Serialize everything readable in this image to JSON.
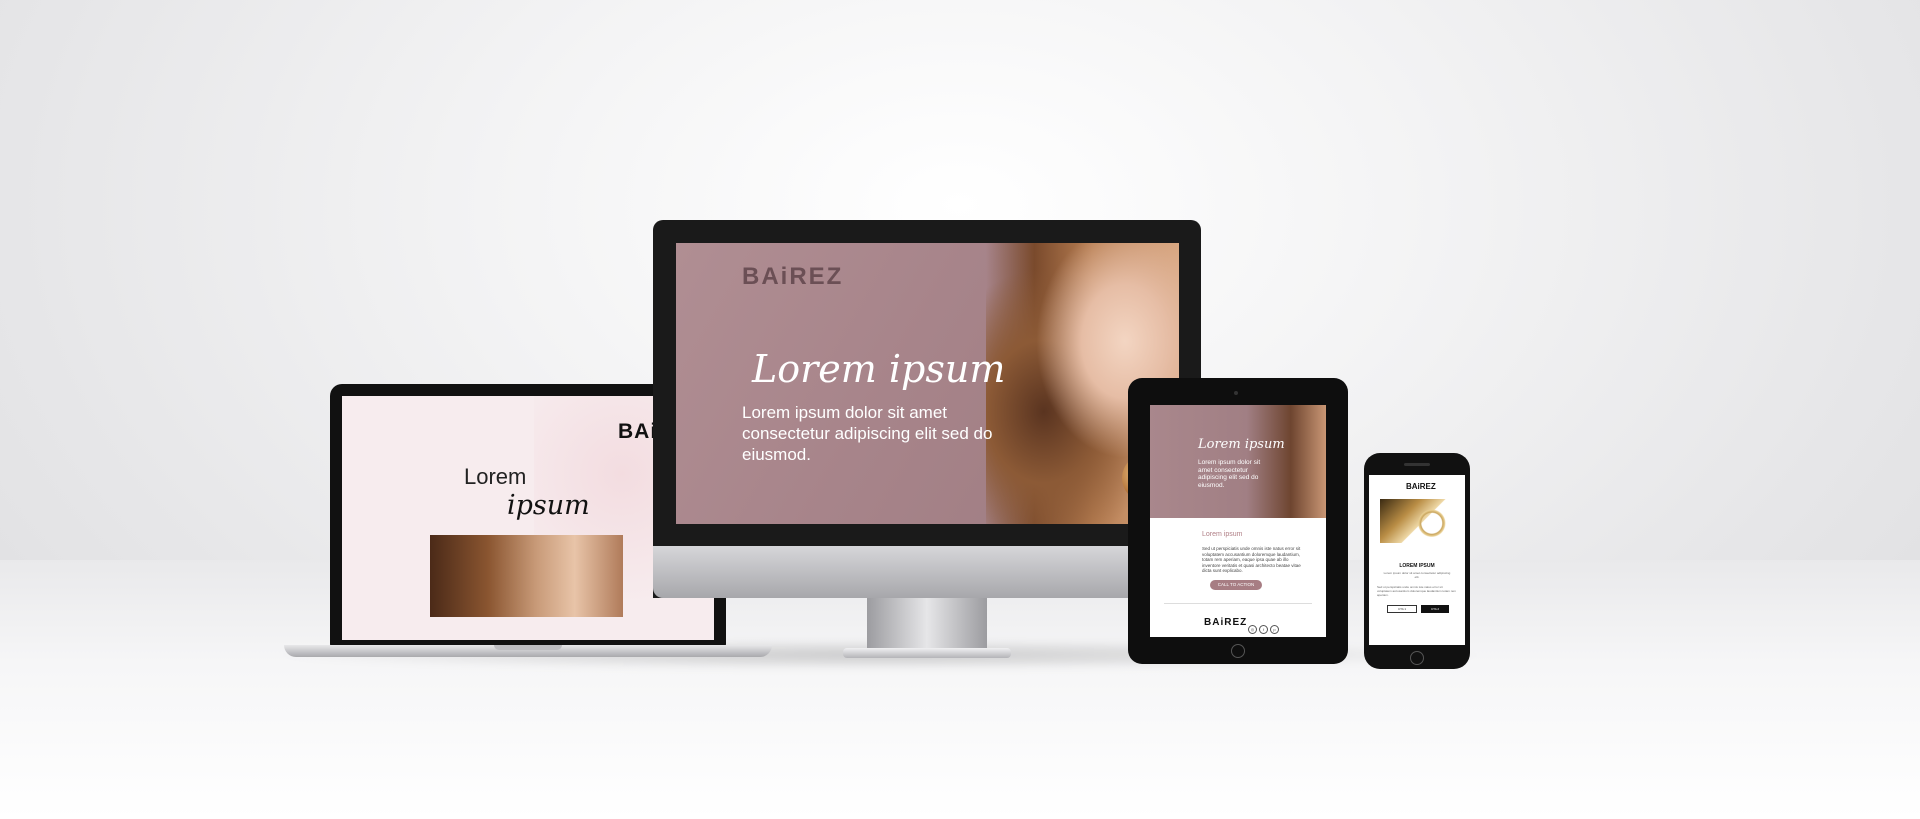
{
  "brand": "BAiREZ",
  "laptop": {
    "logo": "BAi",
    "heading": "Lorem",
    "script": "ipsum"
  },
  "monitor": {
    "logo": "BAiREZ",
    "script": "Lorem ipsum",
    "body": "Lorem ipsum dolor sit amet consectetur adipiscing elit sed do eiusmod."
  },
  "tablet": {
    "script": "Lorem ipsum",
    "hero_text": "Lorem ipsum dolor sit amet consectetur adipiscing elit sed do eiusmod.",
    "subtitle": "Lorem ipsum",
    "body": "Sed ut perspiciatis unde omnis iste natus error sit voluptatem accusantium doloremque laudantium, totam rem aperiam, eaque ipsa quae ab illo inventore veritatis et quasi architecto beatae vitae dicta sunt explicabo.",
    "cta": "CALL TO ACTION",
    "footer_logo": "BAiREZ",
    "social_icons": [
      "instagram-icon",
      "facebook-icon",
      "pinterest-icon"
    ]
  },
  "phone": {
    "logo": "BAiREZ",
    "title": "LOREM IPSUM",
    "text": "Lorem ipsum dolor sit amet consectetur adipiscing elit.",
    "text2": "Sed ut perspiciatis unde omnis iste natus error sit voluptatem accusantium doloremque laudantium totam rem aperiam.",
    "btn1": "CTA 1",
    "btn2": "CTA 2"
  },
  "colors": {
    "mauve": "#a9878c",
    "accent": "#a77d83"
  }
}
